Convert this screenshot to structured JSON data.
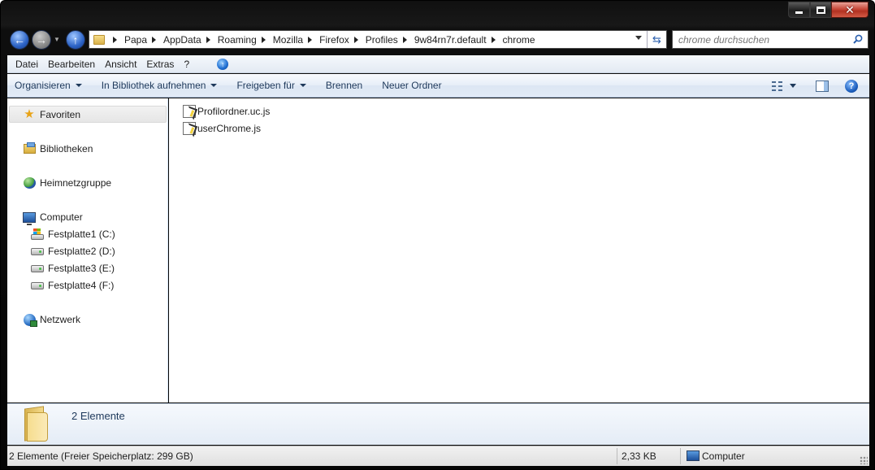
{
  "window": {
    "caption_buttons": [
      "minimize",
      "maximize",
      "close"
    ]
  },
  "navigation": {
    "back_icon": "back-arrow-icon",
    "forward_icon": "forward-arrow-icon",
    "up_icon": "up-arrow-icon"
  },
  "address": {
    "crumbs": [
      "Papa",
      "AppData",
      "Roaming",
      "Mozilla",
      "Firefox",
      "Profiles",
      "9w84rn7r.default",
      "chrome"
    ]
  },
  "search": {
    "placeholder": "chrome durchsuchen"
  },
  "menu": {
    "items": [
      "Datei",
      "Bearbeiten",
      "Ansicht",
      "Extras",
      "?"
    ]
  },
  "commands": {
    "organize": "Organisieren",
    "library": "In Bibliothek aufnehmen",
    "share": "Freigeben für",
    "burn": "Brennen",
    "new_folder": "Neuer Ordner"
  },
  "sidebar": {
    "favorites": "Favoriten",
    "libraries": "Bibliotheken",
    "homegroup": "Heimnetzgruppe",
    "computer": "Computer",
    "drives": [
      "Festplatte1 (C:)",
      "Festplatte2 (D:)",
      "Festplatte3 (E:)",
      "Festplatte4 (F:)"
    ],
    "network": "Netzwerk"
  },
  "files": [
    {
      "name": "Profilordner.uc.js"
    },
    {
      "name": "userChrome.js"
    }
  ],
  "details": {
    "count": "2 Elemente"
  },
  "status": {
    "left": "2 Elemente (Freier Speicherplatz: 299 GB)",
    "size": "2,33 KB",
    "location": "Computer"
  }
}
